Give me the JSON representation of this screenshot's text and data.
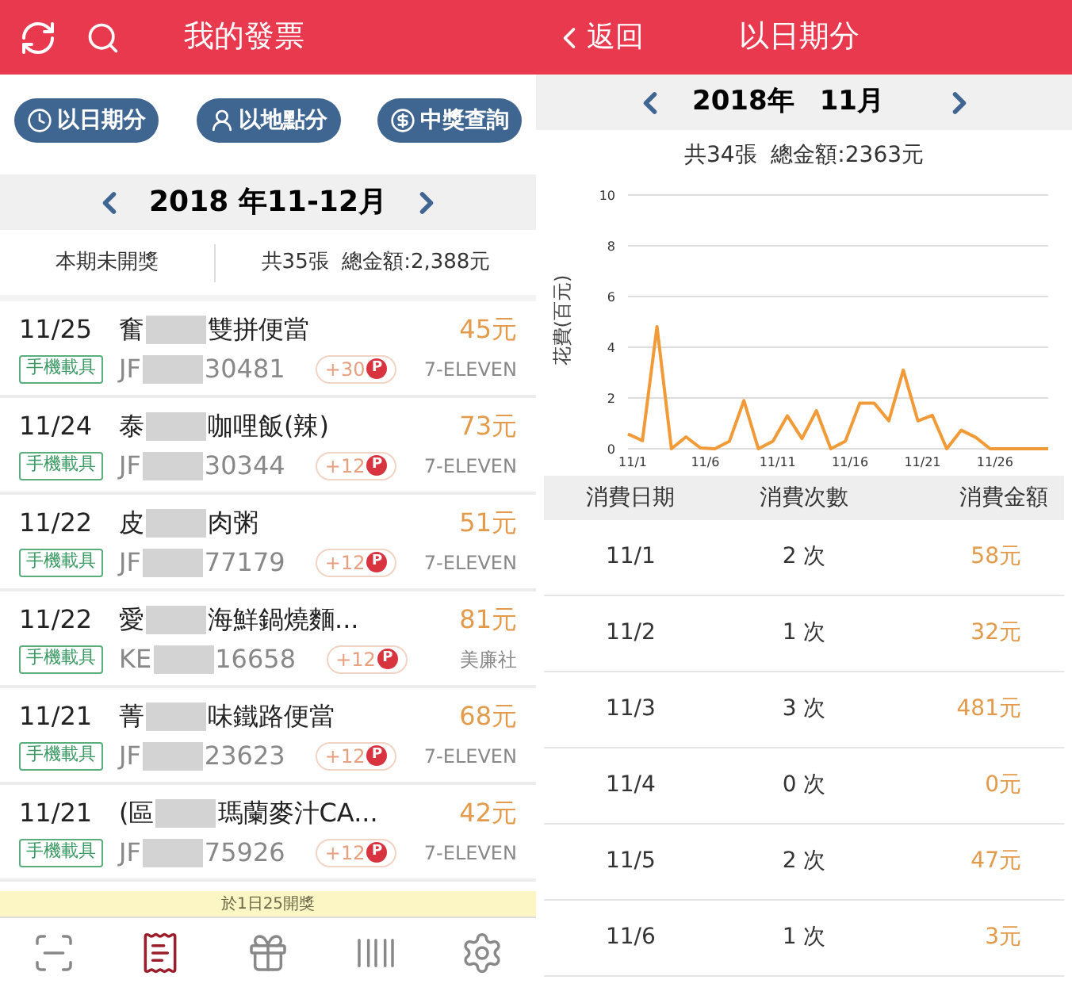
{
  "left": {
    "header": {
      "title": "我的發票"
    },
    "filter_buttons": [
      {
        "label": "以日期分",
        "kind": "clock"
      },
      {
        "label": "以地點分",
        "kind": "person"
      },
      {
        "label": "中獎查詢",
        "kind": "dollar"
      }
    ],
    "period": {
      "label": "2018 年11-12月"
    },
    "summary": {
      "draw_status": "本期未開獎",
      "totals": "共35張  總金額:2,388元"
    },
    "invoices": [
      {
        "date": "11/25",
        "name_start": "奮",
        "name_end": "雙拼便當",
        "carrier": "手機載具",
        "number_start": "JF",
        "number_end": "30481",
        "points": "+30",
        "point_icon": "P",
        "amount": "45元",
        "store": "7-ELEVEN"
      },
      {
        "date": "11/24",
        "name_start": "泰",
        "name_end": "咖哩飯(辣)",
        "carrier": "手機載具",
        "number_start": "JF",
        "number_end": "30344",
        "points": "+12",
        "point_icon": "P",
        "amount": "73元",
        "store": "7-ELEVEN"
      },
      {
        "date": "11/22",
        "name_start": "皮",
        "name_end": "肉粥",
        "carrier": "手機載具",
        "number_start": "JF",
        "number_end": "77179",
        "points": "+12",
        "point_icon": "P",
        "amount": "51元",
        "store": "7-ELEVEN"
      },
      {
        "date": "11/22",
        "name_start": "愛",
        "name_end": "海鮮鍋燒麵...",
        "carrier": "手機載具",
        "number_start": "KE",
        "number_end": "16658",
        "points": "+12",
        "point_icon": "P",
        "amount": "81元",
        "store": "美廉社"
      },
      {
        "date": "11/21",
        "name_start": "菁",
        "name_end": "味鐵路便當",
        "carrier": "手機載具",
        "number_start": "JF",
        "number_end": "23623",
        "points": "+12",
        "point_icon": "P",
        "amount": "68元",
        "store": "7-ELEVEN"
      },
      {
        "date": "11/21",
        "name_start": "(區",
        "name_end": "瑪蘭麥汁CA...",
        "carrier": "手機載具",
        "number_start": "JF",
        "number_end": "75926",
        "points": "+12",
        "point_icon": "P",
        "amount": "42元",
        "store": "7-ELEVEN"
      }
    ],
    "notice": "於1日25開獎",
    "bottom_nav": [
      {
        "kind": "scan",
        "selected": false
      },
      {
        "kind": "invoice",
        "selected": true
      },
      {
        "kind": "gift",
        "selected": false
      },
      {
        "kind": "barcode",
        "selected": false
      },
      {
        "kind": "settings",
        "selected": false
      }
    ]
  },
  "right": {
    "header": {
      "back": "返回",
      "title": "以日期分"
    },
    "month": {
      "year": "2018年",
      "month": "11月"
    },
    "totals": "共34張  總金額:2363元",
    "chart": {
      "chart_data": {
        "type": "line",
        "ylabel": "花費(百元)",
        "categories": [
          "11/1",
          null,
          null,
          null,
          null,
          "11/6",
          null,
          null,
          null,
          null,
          "11/11",
          null,
          null,
          null,
          null,
          "11/16",
          null,
          null,
          null,
          null,
          "11/21",
          null,
          null,
          null,
          null,
          "11/26",
          null,
          null,
          null,
          null
        ],
        "series": [
          {
            "color": "#f09a38",
            "values": [
              0.58,
              0.32,
              4.81,
              0,
              0.47,
              0.03,
              0,
              0.3,
              1.9,
              0,
              0.3,
              1.3,
              0.4,
              1.5,
              0,
              0.3,
              1.8,
              1.8,
              1.1,
              3.1,
              1.1,
              1.32,
              0,
              0.73,
              0.45,
              0,
              0,
              0,
              0,
              0
            ]
          }
        ],
        "ylim": [
          0,
          10
        ],
        "yticks": [
          0,
          2,
          4,
          6,
          8,
          10
        ],
        "grid": true
      }
    },
    "table": {
      "columns": [
        "消費日期",
        "消費次數",
        "消費金額"
      ],
      "rows": [
        {
          "date": "11/1",
          "count": "2 次",
          "amount": "58元"
        },
        {
          "date": "11/2",
          "count": "1 次",
          "amount": "32元"
        },
        {
          "date": "11/3",
          "count": "3 次",
          "amount": "481元"
        },
        {
          "date": "11/4",
          "count": "0 次",
          "amount": "0元"
        },
        {
          "date": "11/5",
          "count": "2 次",
          "amount": "47元"
        },
        {
          "date": "11/6",
          "count": "1 次",
          "amount": "3元"
        }
      ]
    }
  }
}
